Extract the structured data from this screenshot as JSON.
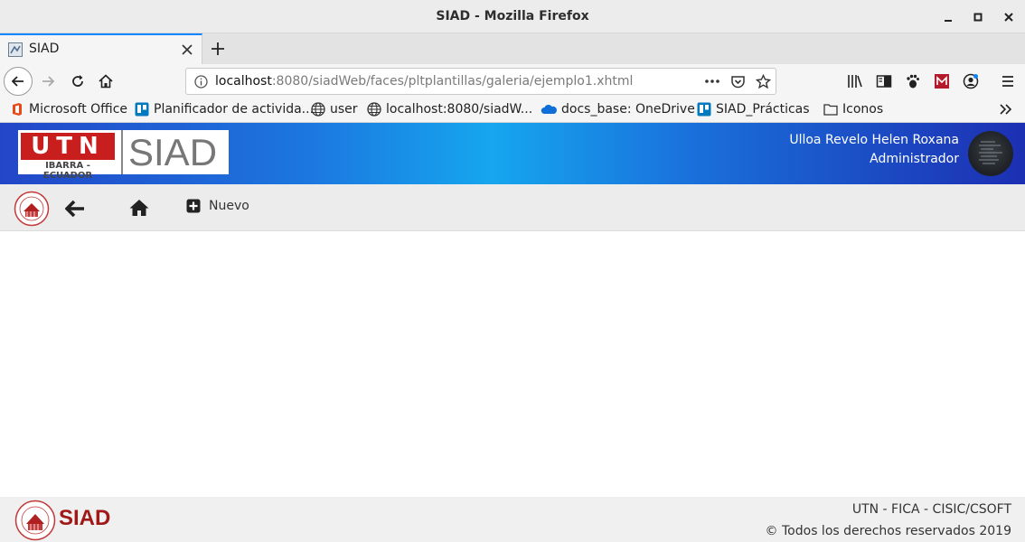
{
  "window": {
    "title": "SIAD - Mozilla Firefox"
  },
  "tabs": [
    {
      "title": "SIAD"
    }
  ],
  "address_bar": {
    "host": "localhost",
    "rest": ":8080/siadWeb/faces/pltplantillas/galeria/ejemplo1.xhtml"
  },
  "bookmarks": [
    {
      "label": "Microsoft Office",
      "icon": "office-icon"
    },
    {
      "label": "Planificador de activida...",
      "icon": "planner-icon"
    },
    {
      "label": "user",
      "icon": "globe-icon"
    },
    {
      "label": "localhost:8080/siadW...",
      "icon": "globe-icon"
    },
    {
      "label": "docs_base: OneDrive",
      "icon": "onedrive-icon"
    },
    {
      "label": "SIAD_Prácticas",
      "icon": "planner-icon"
    },
    {
      "label": "Iconos",
      "icon": "folder-icon"
    }
  ],
  "header": {
    "logo_text": "UTN",
    "logo_subtitle": "IBARRA - ECUADOR",
    "app_name": "SIAD",
    "user_name": "Ulloa Revelo Helen Roxana",
    "user_role": "Administrador"
  },
  "toolbar": {
    "new_label": "Nuevo"
  },
  "footer": {
    "brand": "SIAD",
    "line1": "UTN - FICA - CISIC/CSOFT",
    "line2": "© Todos los derechos reservados 2019"
  },
  "colors": {
    "accent_tab": "#0a84ff",
    "utn_red": "#c81e1e",
    "footer_brand": "#a01818",
    "header_gradient_start": "#2246c7",
    "header_gradient_mid": "#16a6ee",
    "header_gradient_end": "#1c2fb2"
  }
}
